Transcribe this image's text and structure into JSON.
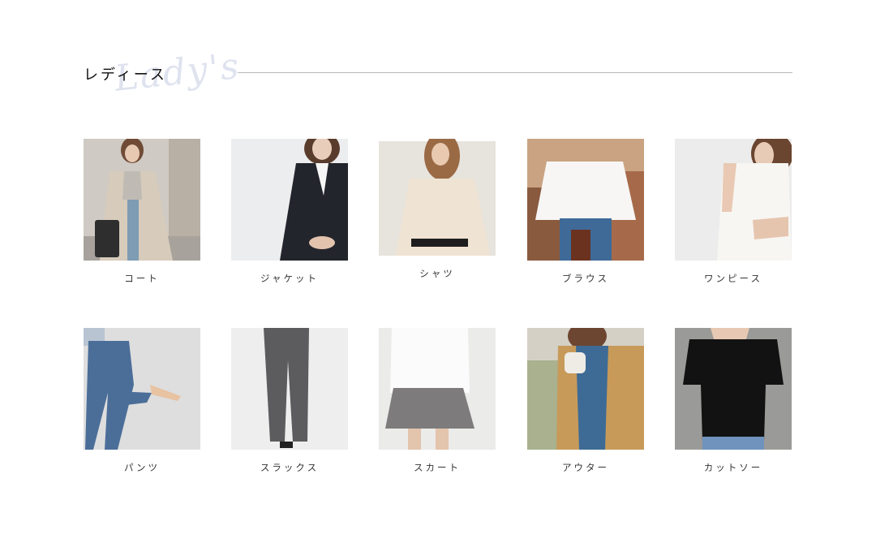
{
  "category": {
    "title_jp": "レディース",
    "title_script": "Lady's"
  },
  "items": [
    {
      "label": "コート",
      "icon": "coat-photo"
    },
    {
      "label": "ジャケット",
      "icon": "jacket-photo"
    },
    {
      "label": "シャツ",
      "icon": "shirt-photo"
    },
    {
      "label": "ブラウス",
      "icon": "blouse-photo"
    },
    {
      "label": "ワンピース",
      "icon": "dress-photo"
    },
    {
      "label": "パンツ",
      "icon": "pants-photo"
    },
    {
      "label": "スラックス",
      "icon": "slacks-photo"
    },
    {
      "label": "スカート",
      "icon": "skirt-photo"
    },
    {
      "label": "アウター",
      "icon": "outerwear-photo"
    },
    {
      "label": "カットソー",
      "icon": "cutsew-photo"
    }
  ],
  "colors": {
    "rule": "#b9b9bd",
    "script": "#dfe3ef"
  }
}
